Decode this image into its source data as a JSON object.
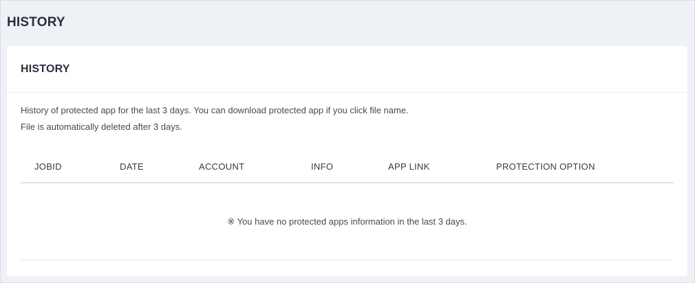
{
  "page": {
    "title": "HISTORY"
  },
  "card": {
    "title": "HISTORY",
    "description_line1": "History of protected app for the last 3 days. You can download protected app if you click file name.",
    "description_line2": "File is automatically deleted after 3 days."
  },
  "table": {
    "columns": [
      "JOBID",
      "DATE",
      "ACCOUNT",
      "INFO",
      "APP LINK",
      "PROTECTION OPTION"
    ],
    "rows": [],
    "empty_message": "※ You have no protected apps information in the last 3 days."
  }
}
